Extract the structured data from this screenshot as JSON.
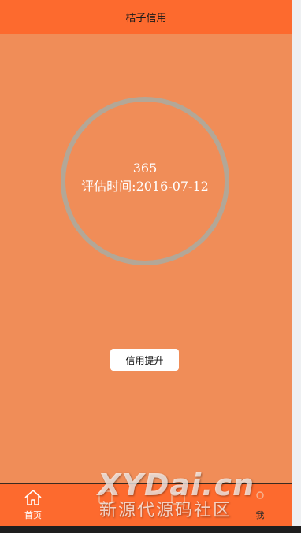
{
  "header": {
    "title": "桔子信用"
  },
  "credit": {
    "score": "365",
    "eval_date": "评估时间:2016-07-12"
  },
  "actions": {
    "boost_label": "信用提升"
  },
  "tabbar": {
    "home_label": "首页",
    "mine_label": "我"
  },
  "watermark": {
    "brand": "XYDai.cn",
    "subtitle": "新源代源码社区"
  },
  "colors": {
    "header_bg": "#fd6a2e",
    "page_bg": "#f08d58",
    "ring": "#b3a797",
    "tabbar_bg": "#fd6a2e"
  }
}
